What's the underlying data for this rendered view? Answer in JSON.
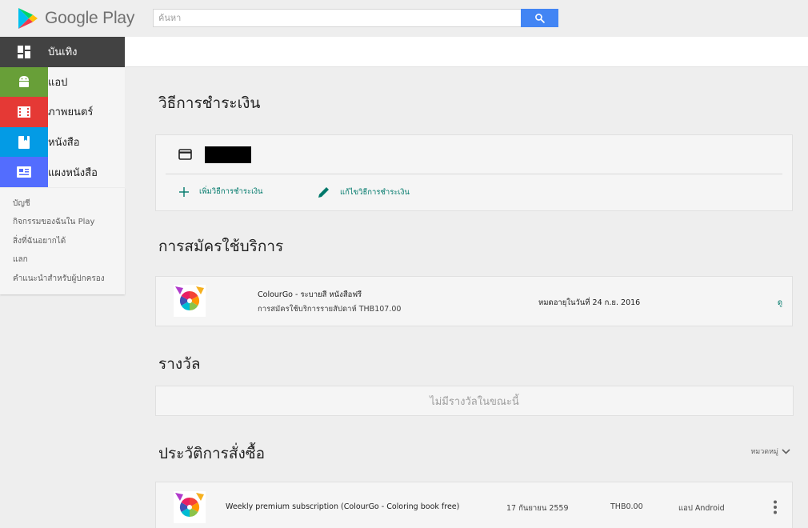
{
  "brand": {
    "name": "Google Play",
    "logo_icon": "google-play-logo"
  },
  "search": {
    "placeholder": "ค้นหา",
    "button_icon": "search-icon"
  },
  "sidebar": {
    "items": [
      {
        "label": "บันเทิง",
        "icon": "entertainment-icon"
      },
      {
        "label": "แอป",
        "icon": "android-icon"
      },
      {
        "label": "ภาพยนตร์",
        "icon": "film-icon"
      },
      {
        "label": "หนังสือ",
        "icon": "book-icon"
      },
      {
        "label": "แผงหนังสือ",
        "icon": "newsstand-icon"
      }
    ],
    "links": [
      "บัญชี",
      "กิจกรรมของฉันใน Play",
      "สิ่งที่ฉันอยากได้",
      "แลก",
      "คำแนะนำสำหรับผู้ปกครอง"
    ]
  },
  "payment": {
    "title": "วิธีการชำระเงิน",
    "add_label": "เพิ่มวิธีการชำระเงิน",
    "edit_label": "แก้ไขวิธีการชำระเงิน"
  },
  "subscriptions": {
    "title": "การสมัครใช้บริการ",
    "item": {
      "name": "ColourGo - ระบายสี หนังสือฟรี",
      "detail": "การสมัครใช้บริการรายสัปดาห์ THB107.00",
      "expiry": "หมดอายุในวันที่ 24 ก.ย. 2016",
      "view_label": "ดู"
    }
  },
  "rewards": {
    "title": "รางวัล",
    "empty_text": "ไม่มีรางวัลในขณะนี้"
  },
  "orders": {
    "title": "ประวัติการสั่งซื้อ",
    "filter_label": "หมวดหมู่",
    "item": {
      "name": "Weekly premium subscription (ColourGo - Coloring book free)",
      "date": "17 กันยายน 2559",
      "price": "THB0.00",
      "type": "แอป Android"
    }
  },
  "colors": {
    "accent_teal": "#00796b",
    "search_blue": "#4285f4",
    "apps_green": "#689f38",
    "movies_red": "#e53935",
    "books_blue": "#039be5",
    "news_indigo": "#536dfe",
    "entertainment_dark": "#424242"
  }
}
